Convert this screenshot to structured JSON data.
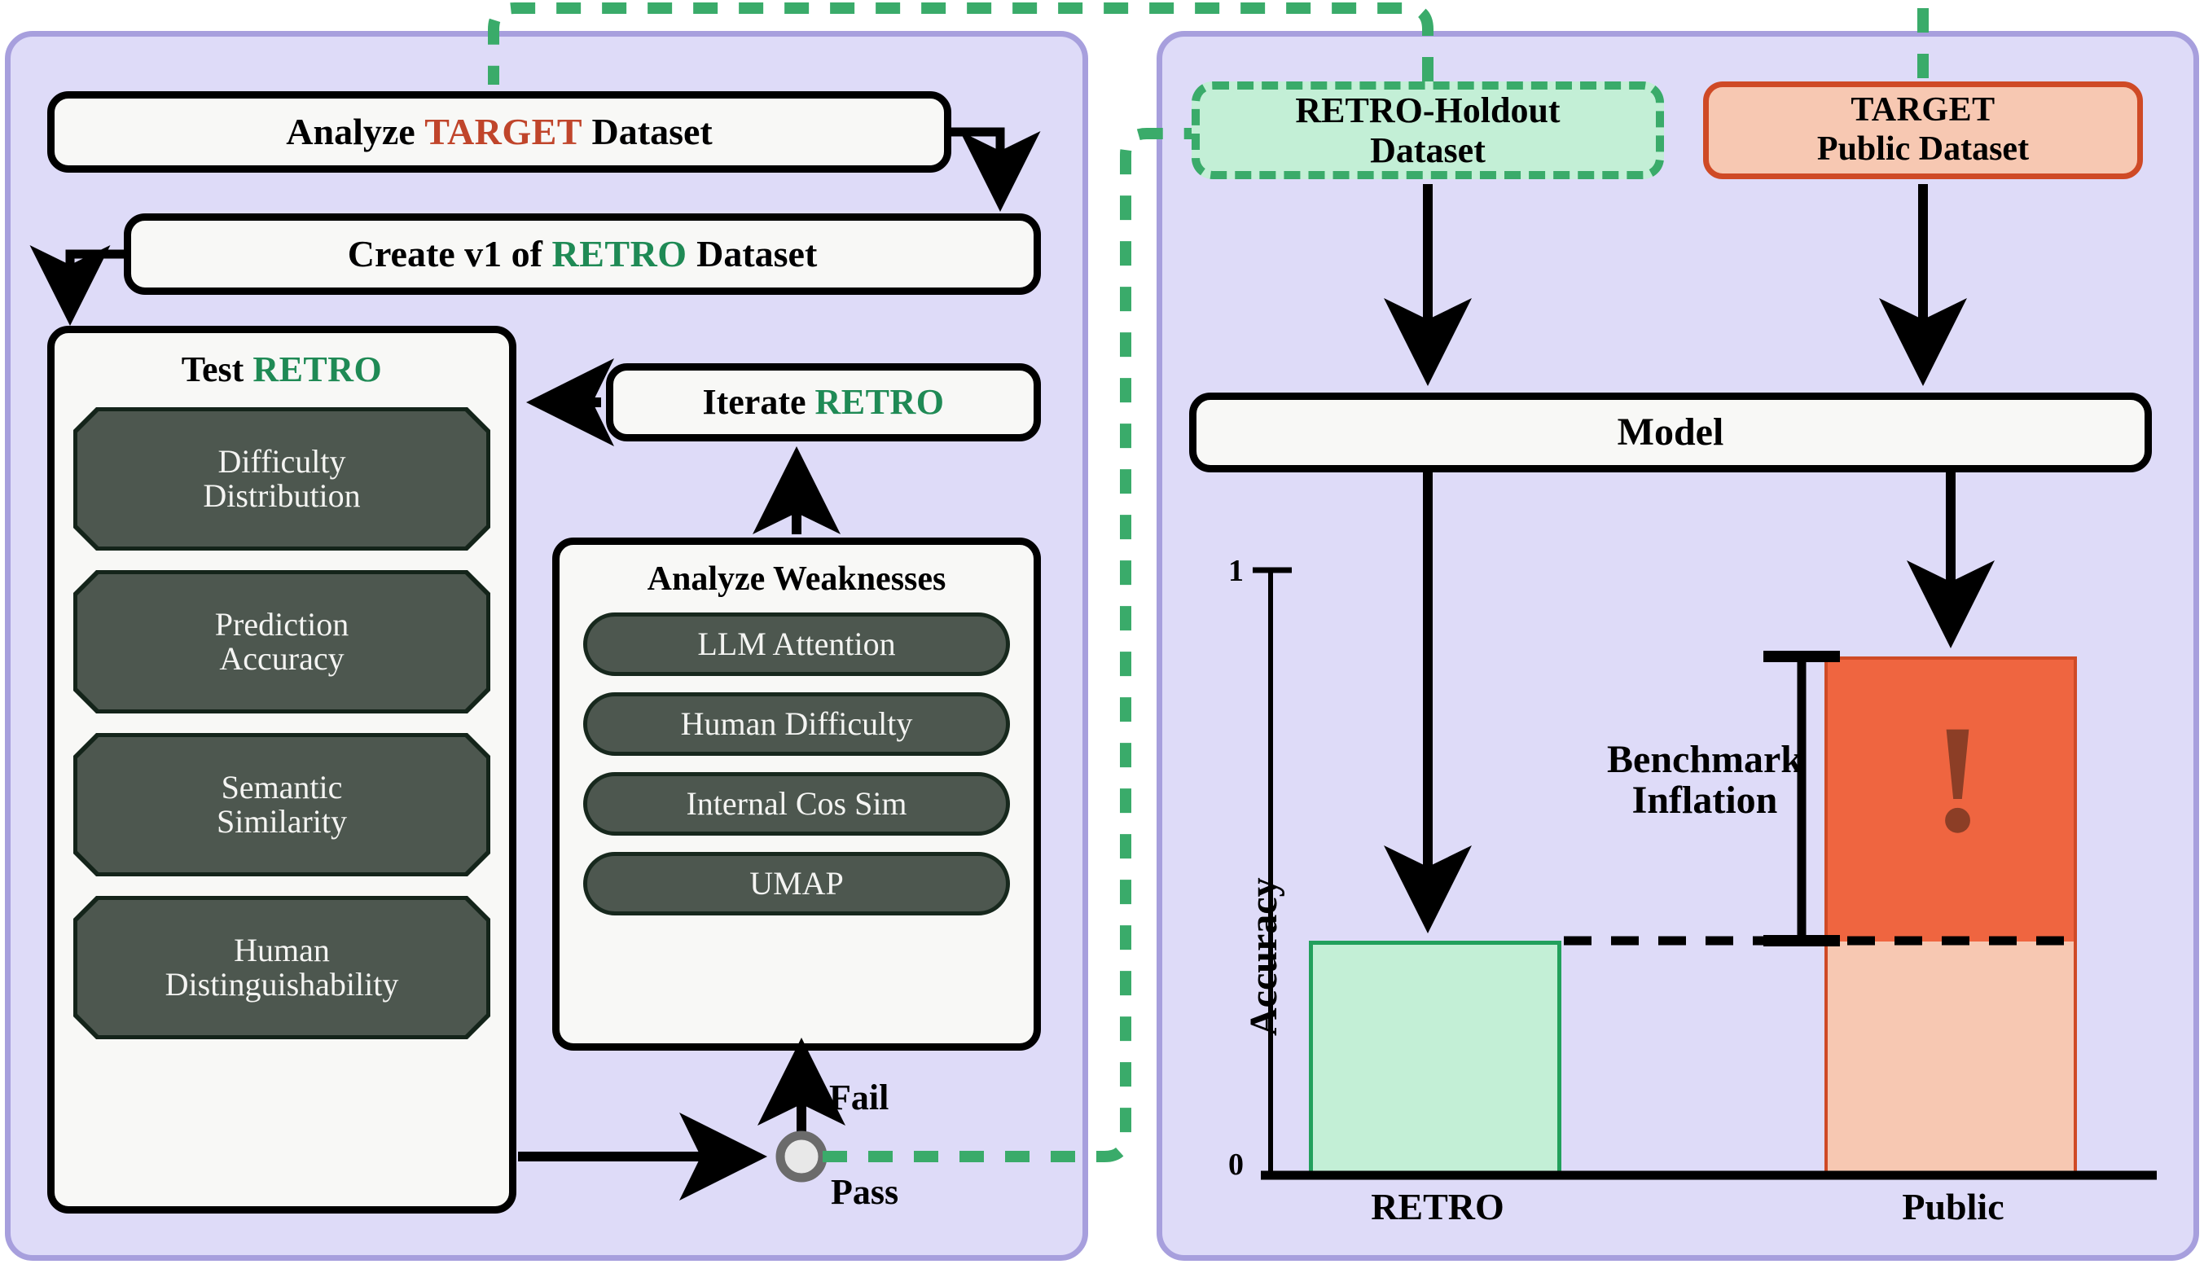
{
  "meta": {
    "colors": {
      "panel_bg": "#dedbf8",
      "panel_border": "#a79fdd",
      "node_bg": "#f8f8f6",
      "node_border": "#000000",
      "chip_fill": "#4d574f",
      "chip_border": "#17281d",
      "chip_text": "#f4f4f2",
      "target_red": "#c0452b",
      "retro_green": "#1f8a55",
      "dash_green": "#3aab6a",
      "green_bar_fill": "#c3efd6",
      "green_bar_stroke": "#22a05c",
      "orange_bar_fill": "#ef6540",
      "orange_bar_light": "#f7c8b2",
      "orange_stroke": "#cf4a26",
      "bang_color": "#8c3e26"
    }
  },
  "left_panel": {
    "analyze_target": {
      "pre": "Analyze ",
      "kw": "TARGET",
      "post": " Dataset"
    },
    "create_v1": {
      "pre": "Create v1 of ",
      "kw": "RETRO",
      "post": " Dataset"
    },
    "test_retro": {
      "title_pre": "Test ",
      "title_kw": "RETRO",
      "chips": [
        "Difficulty\nDistribution",
        "Prediction\nAccuracy",
        "Semantic\nSimilarity",
        "Human\nDistinguishability"
      ]
    },
    "iterate_retro": {
      "pre": "Iterate ",
      "kw": "RETRO"
    },
    "analyze_weaknesses": {
      "title": "Analyze Weaknesses",
      "chips": [
        "LLM Attention",
        "Human Difficulty",
        "Internal Cos Sim",
        "UMAP"
      ]
    },
    "decision": {
      "fail_label": "Fail",
      "pass_label": "Pass"
    }
  },
  "right_panel": {
    "retro_holdout": "RETRO-Holdout\nDataset",
    "retro_holdout_line1": "RETRO-Holdout",
    "retro_holdout_line2": "Dataset",
    "target_public_line1": "TARGET",
    "target_public_line2": "Public Dataset",
    "model": "Model",
    "benchmark_inflation_line1": "Benchmark",
    "benchmark_inflation_line2": "Inflation"
  },
  "chart_data": {
    "type": "bar",
    "title": "",
    "xlabel": "",
    "ylabel": "Accuracy",
    "ylim": [
      0,
      1
    ],
    "ytick_labels": [
      "0",
      "1"
    ],
    "ytick_values": [
      0,
      1
    ],
    "grid": false,
    "legend": null,
    "categories": [
      "RETRO",
      "Public"
    ],
    "values": [
      0.48,
      0.8
    ],
    "annotations": [
      {
        "name": "benchmark-inflation",
        "label": "Benchmark Inflation",
        "from": 0.48,
        "to": 0.8
      },
      {
        "name": "reference-line",
        "label": "",
        "y": 0.48,
        "style": "dashed"
      }
    ],
    "series": [
      {
        "name": "RETRO",
        "value": 0.48,
        "fill": "#c3efd6",
        "stroke": "#22a05c"
      },
      {
        "name": "Public",
        "value": 0.8,
        "fill": "#ef6540",
        "stroke": "#cf4a26",
        "below_reference_fill": "#f7c8b2",
        "marker": "!"
      }
    ]
  }
}
